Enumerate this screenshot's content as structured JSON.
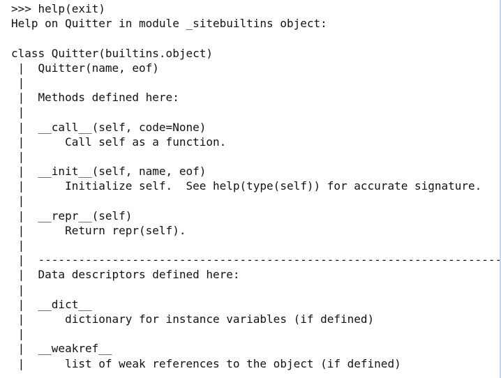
{
  "console": {
    "lines": [
      ">>> help(exit)",
      "Help on Quitter in module _sitebuiltins object:",
      "",
      "class Quitter(builtins.object)",
      " |  Quitter(name, eof)",
      " |",
      " |  Methods defined here:",
      " |",
      " |  __call__(self, code=None)",
      " |      Call self as a function.",
      " |",
      " |  __init__(self, name, eof)",
      " |      Initialize self.  See help(type(self)) for accurate signature.",
      " |",
      " |  __repr__(self)",
      " |      Return repr(self).",
      " |",
      " |  ----------------------------------------------------------------------",
      " |  Data descriptors defined here:",
      " |",
      " |  __dict__",
      " |      dictionary for instance variables (if defined)",
      " |",
      " |  __weakref__",
      " |      list of weak references to the object (if defined)"
    ]
  }
}
